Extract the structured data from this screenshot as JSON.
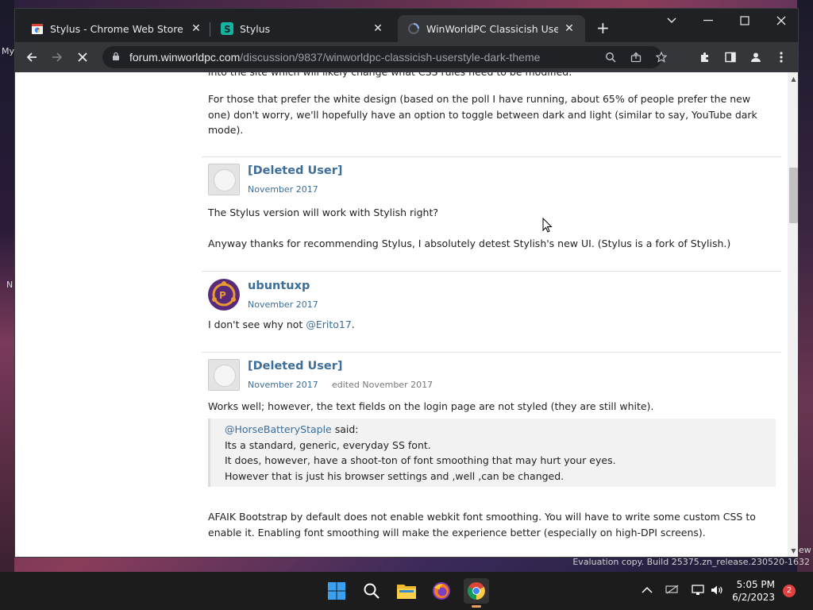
{
  "desktop": {
    "left_label_top": "My",
    "left_label_mid": "N",
    "right_label": "ew",
    "evaluation_text": "Evaluation copy. Build 25375.zn_release.230520-1632"
  },
  "browser": {
    "tabs": [
      {
        "title": "Stylus - Chrome Web Store",
        "icon": "chrome-web-store-icon"
      },
      {
        "title": "Stylus",
        "icon": "stylus-icon"
      },
      {
        "title": "WinWorldPC Classicish Userstyle",
        "icon": "loading-spinner-icon",
        "active": true
      }
    ],
    "new_tab_label": "+",
    "url_host": "forum.winworldpc.com",
    "url_path": "/discussion/9837/winworldpc-classicish-userstyle-dark-theme"
  },
  "thread": {
    "cut_line": "into the site which will likely change what CSS rules need to be modified.",
    "intro_paragraph": "For those that prefer the white design (based on the poll I have running, about 65% of people prefer the new one) don't worry, we'll hopefully have an option to toggle between dark and light (similar to say, YouTube dark mode).",
    "comments": [
      {
        "author": "[Deleted User]",
        "date": "November 2017",
        "body": [
          "The Stylus version will work with Stylish right?",
          "Anyway thanks for recommending Stylus, I absolutely detest Stylish's new UI. (Stylus is a fork of Stylish.)"
        ]
      },
      {
        "author": "ubuntuxp",
        "date": "November 2017",
        "body_prefix": "I don't see why not ",
        "mention": "@Erito17",
        "body_suffix": "."
      },
      {
        "author": "[Deleted User]",
        "date": "November 2017",
        "edited": "edited November 2017",
        "body": "Works well; however, the text fields on the login page are not styled (they are still white).",
        "quote": {
          "author": "@HorseBatteryStaple",
          "said": " said:",
          "lines": [
            "Its a standard, generic, everyday SS font.",
            "It does, however, have a shoot-ton of font smoothing that may hurt your eyes.",
            "However that is just his browser settings and ,well ,can be changed."
          ]
        },
        "after_quote": "AFAIK Bootstrap by default does not enable webkit font smoothing. You will have to write some custom CSS to enable it. Enabling font smoothing will make the experience better (especially on high-DPI screens)."
      }
    ]
  },
  "taskbar": {
    "time": "5:05 PM",
    "date": "6/2/2023",
    "notification_count": "2"
  }
}
